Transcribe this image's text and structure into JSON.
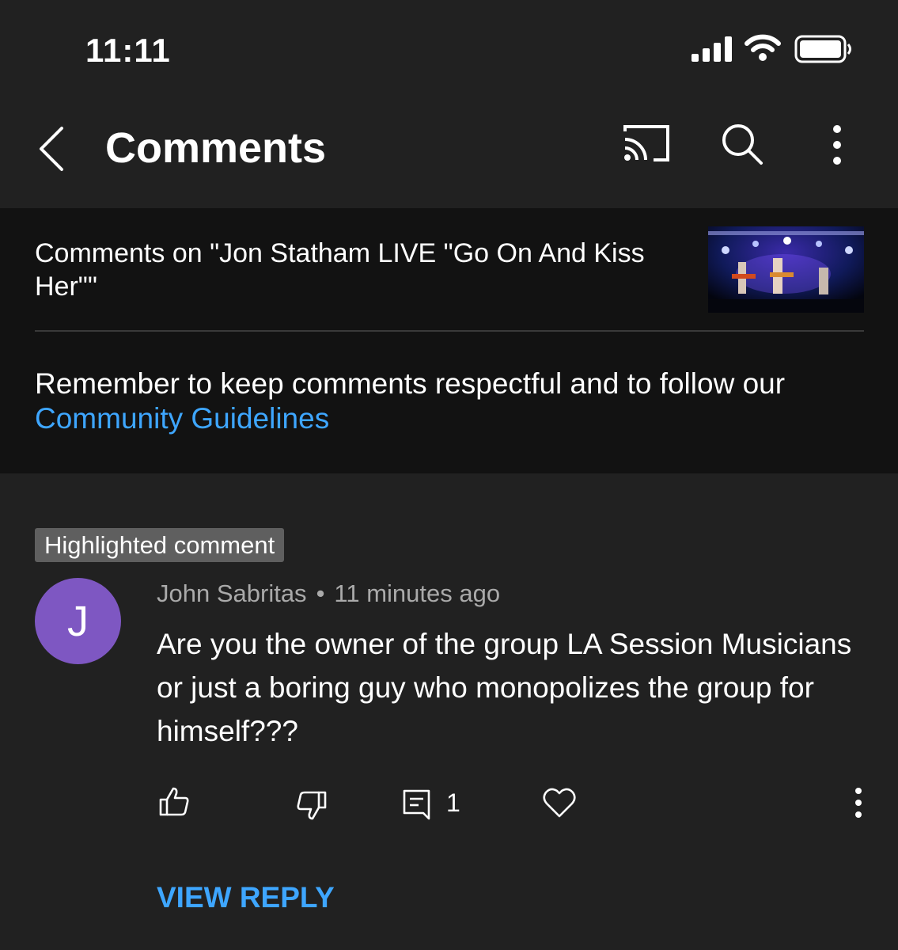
{
  "status_bar": {
    "time": "11:11",
    "icons": [
      "signal-icon",
      "wifi-icon",
      "battery-icon"
    ]
  },
  "app_bar": {
    "title": "Comments",
    "icons": [
      "back-icon",
      "cast-icon",
      "search-icon",
      "more-icon"
    ]
  },
  "header": {
    "video_title": "Comments on \"Jon Statham LIVE \"Go On And Kiss Her\"\"",
    "guidelines_text": "Remember to keep comments respectful and to follow our",
    "guidelines_link": "Community Guidelines"
  },
  "comment": {
    "badge": "Highlighted comment",
    "avatar_initial": "J",
    "author": "John Sabritas",
    "separator": "•",
    "time": "11 minutes ago",
    "text": "Are you the owner of the group LA Session Musicians or just a boring guy who monopolizes the group for himself???",
    "reply_count": "1",
    "view_reply_label": "VIEW REPLY",
    "action_icons": [
      "like-icon",
      "dislike-icon",
      "reply-icon",
      "heart-icon",
      "more-icon"
    ]
  },
  "colors": {
    "background": "#212121",
    "header_panel": "#121212",
    "link": "#3ea6ff",
    "avatar": "#7e57c2",
    "badge": "#5f5f5f",
    "meta_text": "#aaaaaa"
  }
}
